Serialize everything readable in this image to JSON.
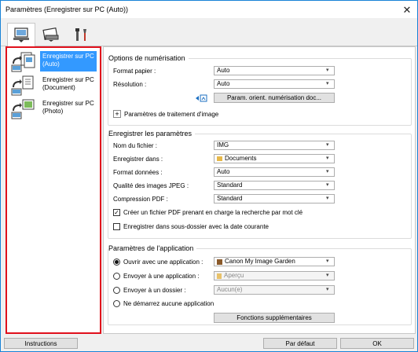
{
  "window": {
    "title": "Paramètres (Enregistrer sur PC (Auto))",
    "close_glyph": "✕"
  },
  "tabs": [
    {
      "icon": "computer-scan-icon"
    },
    {
      "icon": "scanner-icon"
    },
    {
      "icon": "tools-icon"
    }
  ],
  "sidebar": {
    "items": [
      {
        "label_line1": "Enregistrer sur PC",
        "label_line2": "(Auto)",
        "selected": true
      },
      {
        "label_line1": "Enregistrer sur PC",
        "label_line2": "(Document)",
        "selected": false
      },
      {
        "label_line1": "Enregistrer sur PC",
        "label_line2": "(Photo)",
        "selected": false
      }
    ]
  },
  "scan_options": {
    "title": "Options de numérisation",
    "paper_size_label": "Format papier :",
    "paper_size_value": "Auto",
    "resolution_label": "Résolution :",
    "resolution_value": "Auto",
    "orient_button": "Param. orient. numérisation doc...",
    "image_processing_label": "Paramètres de traitement d'image",
    "expand_glyph": "+"
  },
  "save_settings": {
    "title": "Enregistrer les paramètres",
    "filename_label": "Nom du fichier :",
    "filename_value": "IMG",
    "save_in_label": "Enregistrer dans :",
    "save_in_value": "Documents",
    "data_format_label": "Format données :",
    "data_format_value": "Auto",
    "jpeg_quality_label": "Qualité des images JPEG :",
    "jpeg_quality_value": "Standard",
    "pdf_compression_label": "Compression PDF :",
    "pdf_compression_value": "Standard",
    "searchable_pdf_label": "Créer un fichier PDF prenant en charge la recherche par mot clé",
    "searchable_pdf_checked": true,
    "subfolder_label": "Enregistrer dans sous-dossier avec la date courante",
    "subfolder_checked": false,
    "check_glyph": "✓"
  },
  "app_settings": {
    "title": "Paramètres de l'application",
    "open_with_label": "Ouvrir avec une application :",
    "open_with_value": "Canon My Image Garden",
    "send_app_label": "Envoyer à une application :",
    "send_app_value": "Aperçu",
    "send_folder_label": "Envoyer à un dossier :",
    "send_folder_value": "Aucun(e)",
    "no_app_label": "Ne démarrez aucune application",
    "more_functions_button": "Fonctions supplémentaires"
  },
  "footer": {
    "instructions_button": "Instructions",
    "default_button": "Par défaut",
    "ok_button": "OK"
  },
  "colors": {
    "accent": "#3399ff",
    "highlight_border": "#e0101c",
    "window_border": "#1883d7"
  }
}
